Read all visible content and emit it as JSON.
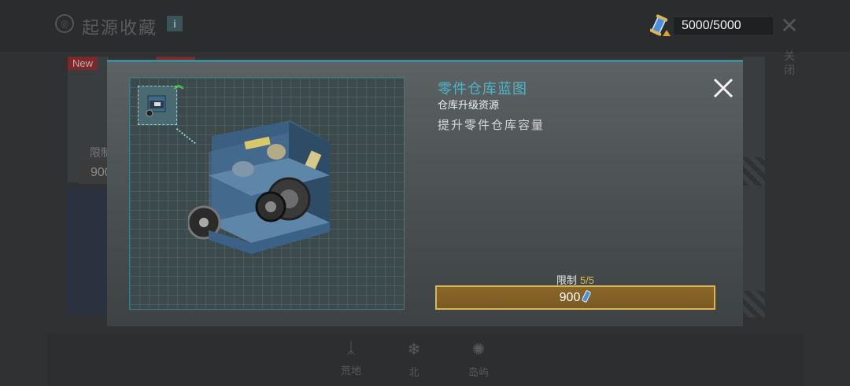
{
  "background": {
    "title": "起源收藏",
    "info_glyph": "i",
    "new_badge": "New",
    "card_limit": "限制",
    "card_price": "900",
    "side_label": "关闭",
    "resource": {
      "icon": "blueprint-scroll-icon",
      "text": "5000/5000"
    },
    "nav": [
      {
        "label": "荒地",
        "icon": "grass-icon"
      },
      {
        "label": "北",
        "icon": "snowflake-icon"
      },
      {
        "label": "岛屿",
        "icon": "island-icon"
      }
    ]
  },
  "modal": {
    "title": "零件仓库蓝图",
    "subtitle": "仓库升级资源",
    "description": "提升零件仓库容量",
    "limit_label": "限制",
    "limit_value": "5/5",
    "price": "900",
    "accent_color": "#4fb5c6",
    "button_color": "#7b5a22"
  }
}
